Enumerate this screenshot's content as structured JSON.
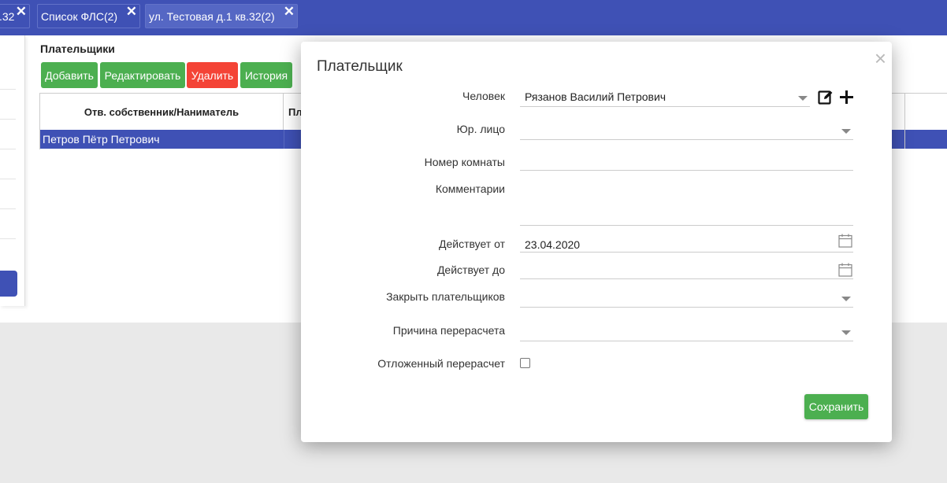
{
  "tabs": [
    {
      "label": ".32",
      "close": "✕"
    },
    {
      "label": "Список ФЛС(2)",
      "close": "✕"
    },
    {
      "label": "ул. Тестовая д.1 кв.32(2)",
      "close": "✕"
    }
  ],
  "section": {
    "title": "Плательщики"
  },
  "toolbar": {
    "add_label": "Добавить",
    "edit_label": "Редактировать",
    "delete_label": "Удалить",
    "history_label": "История"
  },
  "table": {
    "columns": [
      "Отв. собственник/Наниматель",
      "Пл"
    ],
    "rows": [
      {
        "owner": "Петров Пётр Петрович"
      }
    ]
  },
  "modal": {
    "title": "Плательщик",
    "close": "×",
    "fields": {
      "person": {
        "label": "Человек",
        "value": "Рязанов Василий Петрович"
      },
      "legal_entity": {
        "label": "Юр. лицо",
        "value": ""
      },
      "room_number": {
        "label": "Номер комнаты",
        "value": ""
      },
      "comments": {
        "label": "Комментарии",
        "value": ""
      },
      "valid_from": {
        "label": "Действует от",
        "value": "23.04.2020"
      },
      "valid_to": {
        "label": "Действует до",
        "value": ""
      },
      "close_payers": {
        "label": "Закрыть плательщиков",
        "value": ""
      },
      "recalc_reason": {
        "label": "Причина перерасчета",
        "value": ""
      },
      "deferred_recalc": {
        "label": "Отложенный перерасчет",
        "checked": false
      }
    },
    "save_label": "Сохранить"
  },
  "colors": {
    "primary": "#3f51b5",
    "success": "#4caf50",
    "danger": "#f44336"
  },
  "icons": [
    "close-icon",
    "caret-down-icon",
    "edit-icon",
    "plus-icon",
    "calendar-icon",
    "checkbox"
  ]
}
